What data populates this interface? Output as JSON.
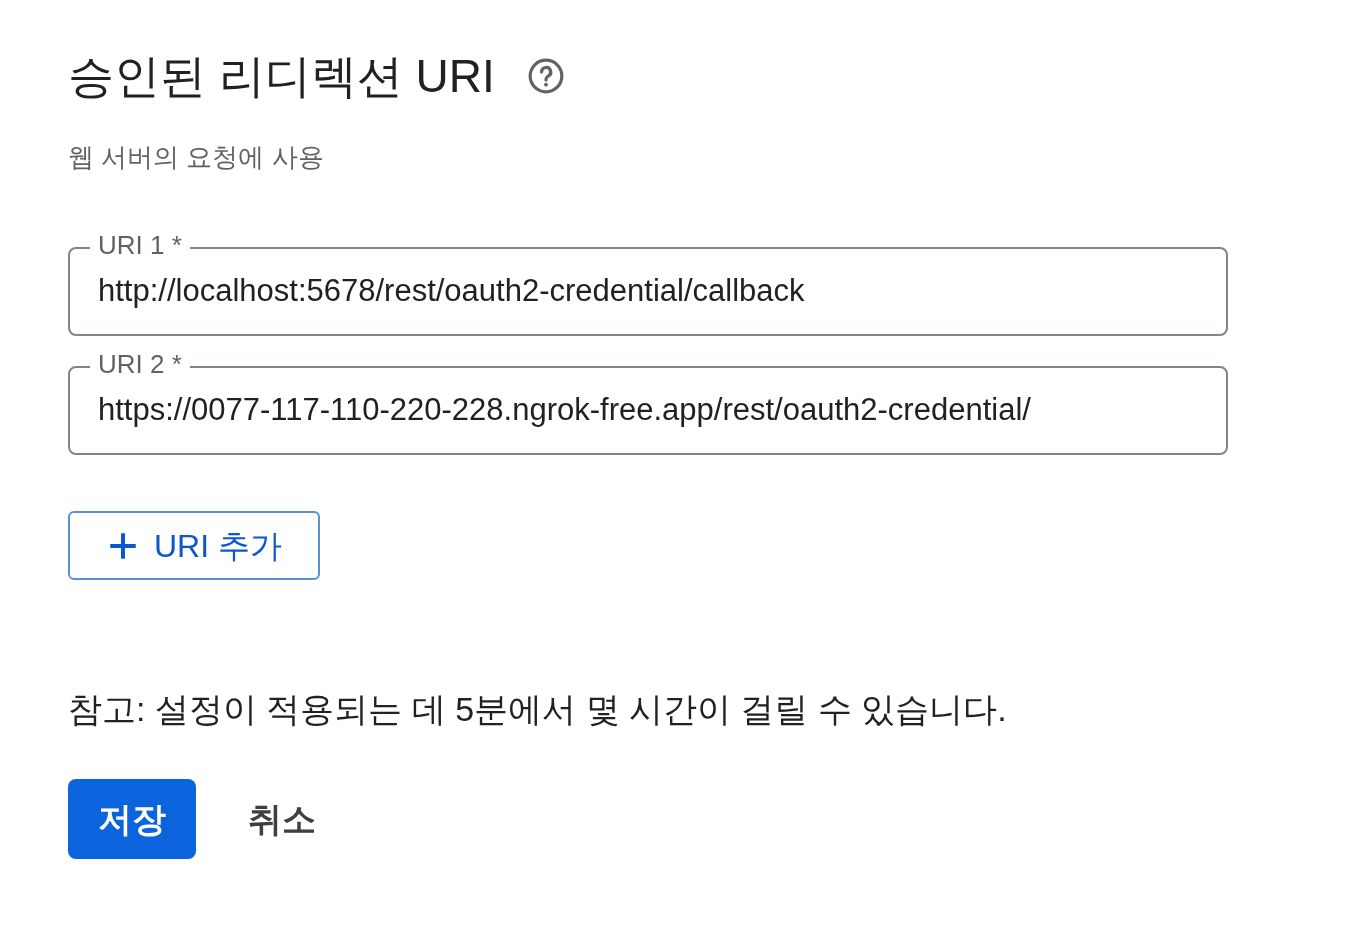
{
  "title": "승인된 리디렉션 URI",
  "subtitle": "웹 서버의 요청에 사용",
  "fields": [
    {
      "label": "URI 1 *",
      "value": "http://localhost:5678/rest/oauth2-credential/callback"
    },
    {
      "label": "URI 2 *",
      "value": "https://0077-117-110-220-228.ngrok-free.app/rest/oauth2-credential/"
    }
  ],
  "add_button": "URI 추가",
  "note": "참고: 설정이 적용되는 데 5분에서 몇 시간이 걸릴 수 있습니다.",
  "buttons": [
    {
      "label": "저장",
      "kind": "primary"
    },
    {
      "label": "취소",
      "kind": "text"
    }
  ]
}
